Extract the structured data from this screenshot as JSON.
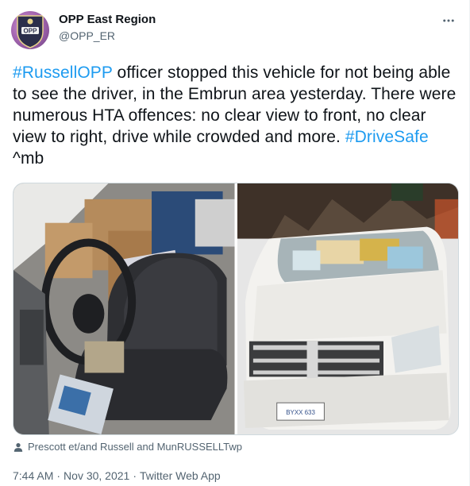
{
  "author": {
    "display_name": "OPP East Region",
    "handle": "@OPP_ER",
    "avatar_text": "OPP"
  },
  "tweet": {
    "segments": [
      {
        "text": "#RussellOPP",
        "type": "hashtag"
      },
      {
        "text": " officer stopped this vehicle for not being able to see the driver, in the Embrun area yesterday. There were numerous HTA offences: no clear view to front, no clear view to right, drive while crowded and more. ",
        "type": "text"
      },
      {
        "text": "#DriveSafe",
        "type": "hashtag"
      },
      {
        "text": " ^mb",
        "type": "text"
      }
    ]
  },
  "media": {
    "tagged_users": "Prescott et/and Russell and MunRUSSELLTwp",
    "plate_text": "BYXX 633"
  },
  "meta": {
    "time": "7:44 AM",
    "date": "Nov 30, 2021",
    "source": "Twitter Web App",
    "separator": "·"
  },
  "icons": {
    "more": "more-horizontal-icon",
    "tag": "person-icon"
  },
  "colors": {
    "accent": "#1d9bf0",
    "secondary_text": "#536471",
    "primary_text": "#0f1419"
  }
}
